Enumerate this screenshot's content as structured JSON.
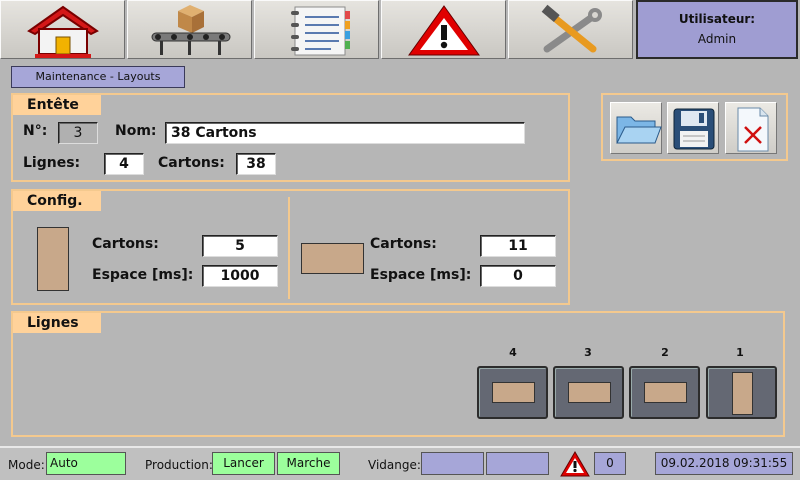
{
  "nav": {
    "items": [
      {
        "icon": "home-icon"
      },
      {
        "icon": "conveyor-icon"
      },
      {
        "icon": "notebook-icon"
      },
      {
        "icon": "warning-icon"
      },
      {
        "icon": "tools-icon"
      }
    ]
  },
  "user": {
    "label": "Utilisateur:",
    "name": "Admin"
  },
  "breadcrumb": "Maintenance - Layouts",
  "entete": {
    "title": "Entête",
    "num_label": "N°:",
    "num_value": "3",
    "nom_label": "Nom:",
    "nom_value": "38 Cartons",
    "lignes_label": "Lignes:",
    "lignes_value": "4",
    "cartons_label": "Cartons:",
    "cartons_value": "38"
  },
  "toolbar": {
    "open_icon": "folder-open-icon",
    "save_icon": "floppy-save-icon",
    "delete_icon": "delete-document-icon"
  },
  "config": {
    "title": "Config.",
    "left": {
      "cartons_label": "Cartons:",
      "cartons_value": "5",
      "espace_label": "Espace [ms]:",
      "espace_value": "1000"
    },
    "right": {
      "cartons_label": "Cartons:",
      "cartons_value": "11",
      "espace_label": "Espace [ms]:",
      "espace_value": "0"
    }
  },
  "lignes": {
    "title": "Lignes",
    "items": [
      {
        "number": "4"
      },
      {
        "number": "3"
      },
      {
        "number": "2"
      },
      {
        "number": "1"
      }
    ]
  },
  "status": {
    "mode_label": "Mode:",
    "mode_value": "Auto",
    "production_label": "Production:",
    "lancer": "Lancer",
    "marche": "Marche",
    "vidange_label": "Vidange:",
    "alarm_count": "0",
    "datetime": "09.02.2018 09:31:55"
  }
}
